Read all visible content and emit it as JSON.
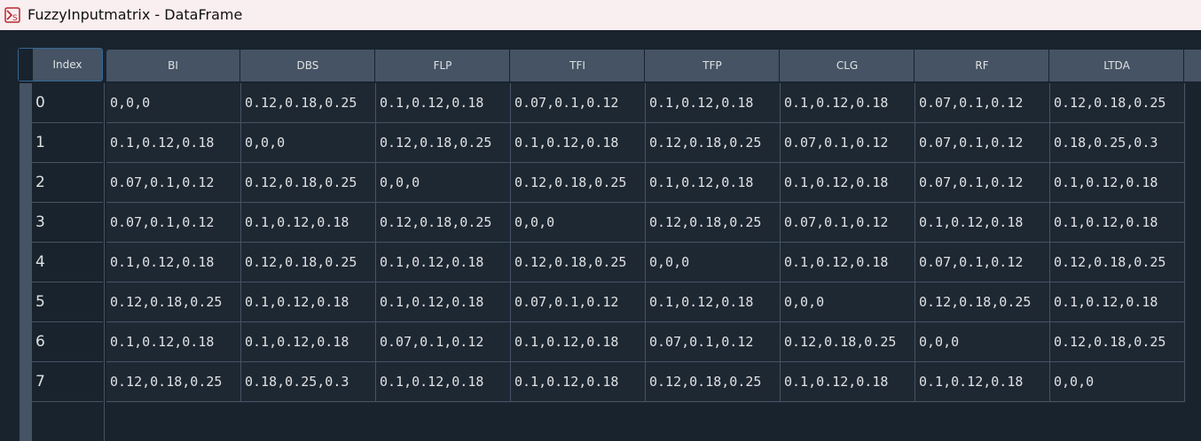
{
  "window": {
    "title": "FuzzyInputmatrix - DataFrame",
    "icon": "spyder-variable-explorer-icon"
  },
  "table": {
    "index_header": "Index",
    "columns": [
      "BI",
      "DBS",
      "FLP",
      "TFI",
      "TFP",
      "CLG",
      "RF",
      "LTDA"
    ],
    "index": [
      "0",
      "1",
      "2",
      "3",
      "4",
      "5",
      "6",
      "7"
    ],
    "rows": [
      [
        "0,0,0",
        "0.12,0.18,0.25",
        "0.1,0.12,0.18",
        "0.07,0.1,0.12",
        "0.1,0.12,0.18",
        "0.1,0.12,0.18",
        "0.07,0.1,0.12",
        "0.12,0.18,0.25"
      ],
      [
        "0.1,0.12,0.18",
        "0,0,0",
        "0.12,0.18,0.25",
        "0.1,0.12,0.18",
        "0.12,0.18,0.25",
        "0.07,0.1,0.12",
        "0.07,0.1,0.12",
        "0.18,0.25,0.3"
      ],
      [
        "0.07,0.1,0.12",
        "0.12,0.18,0.25",
        "0,0,0",
        "0.12,0.18,0.25",
        "0.1,0.12,0.18",
        "0.1,0.12,0.18",
        "0.07,0.1,0.12",
        "0.1,0.12,0.18"
      ],
      [
        "0.07,0.1,0.12",
        "0.1,0.12,0.18",
        "0.12,0.18,0.25",
        "0,0,0",
        "0.12,0.18,0.25",
        "0.07,0.1,0.12",
        "0.1,0.12,0.18",
        "0.1,0.12,0.18"
      ],
      [
        "0.1,0.12,0.18",
        "0.12,0.18,0.25",
        "0.1,0.12,0.18",
        "0.12,0.18,0.25",
        "0,0,0",
        "0.1,0.12,0.18",
        "0.07,0.1,0.12",
        "0.12,0.18,0.25"
      ],
      [
        "0.12,0.18,0.25",
        "0.1,0.12,0.18",
        "0.1,0.12,0.18",
        "0.07,0.1,0.12",
        "0.1,0.12,0.18",
        "0,0,0",
        "0.12,0.18,0.25",
        "0.1,0.12,0.18"
      ],
      [
        "0.1,0.12,0.18",
        "0.1,0.12,0.18",
        "0.07,0.1,0.12",
        "0.1,0.12,0.18",
        "0.07,0.1,0.12",
        "0.12,0.18,0.25",
        "0,0,0",
        "0.12,0.18,0.25"
      ],
      [
        "0.12,0.18,0.25",
        "0.18,0.25,0.3",
        "0.1,0.12,0.18",
        "0.1,0.12,0.18",
        "0.12,0.18,0.25",
        "0.1,0.12,0.18",
        "0.1,0.12,0.18",
        "0,0,0"
      ]
    ]
  },
  "colors": {
    "background": "#19232d",
    "header": "#455364",
    "grid_line": "#455364",
    "accent": "#346792",
    "text": "#e0e1e3"
  }
}
